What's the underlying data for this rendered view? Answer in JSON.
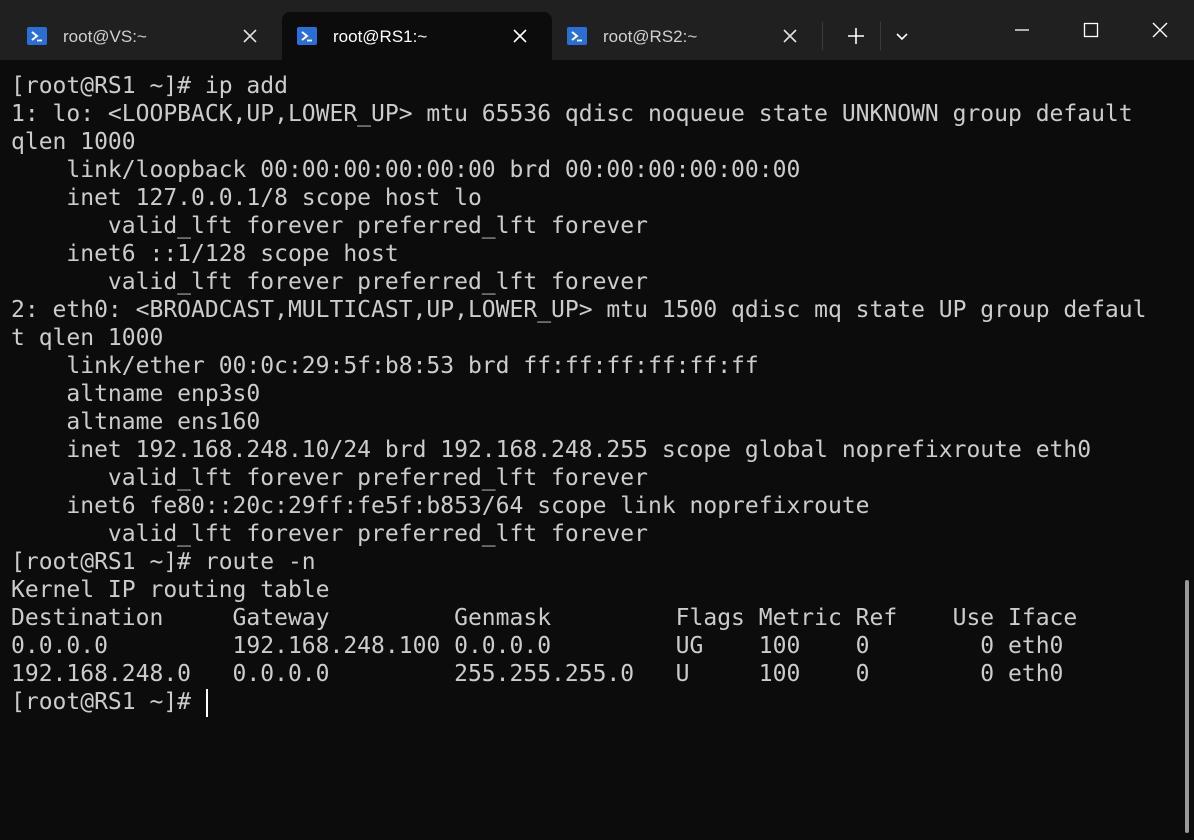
{
  "window": {
    "tabs": [
      {
        "title": "root@VS:~",
        "active": false
      },
      {
        "title": "root@RS1:~",
        "active": true
      },
      {
        "title": "root@RS2:~",
        "active": false
      }
    ]
  },
  "terminal": {
    "lines": [
      "[root@RS1 ~]# ip add",
      "1: lo: <LOOPBACK,UP,LOWER_UP> mtu 65536 qdisc noqueue state UNKNOWN group default",
      "qlen 1000",
      "    link/loopback 00:00:00:00:00:00 brd 00:00:00:00:00:00",
      "    inet 127.0.0.1/8 scope host lo",
      "       valid_lft forever preferred_lft forever",
      "    inet6 ::1/128 scope host",
      "       valid_lft forever preferred_lft forever",
      "2: eth0: <BROADCAST,MULTICAST,UP,LOWER_UP> mtu 1500 qdisc mq state UP group defaul",
      "t qlen 1000",
      "    link/ether 00:0c:29:5f:b8:53 brd ff:ff:ff:ff:ff:ff",
      "    altname enp3s0",
      "    altname ens160",
      "    inet 192.168.248.10/24 brd 192.168.248.255 scope global noprefixroute eth0",
      "       valid_lft forever preferred_lft forever",
      "    inet6 fe80::20c:29ff:fe5f:b853/64 scope link noprefixroute",
      "       valid_lft forever preferred_lft forever",
      "[root@RS1 ~]# route -n",
      "Kernel IP routing table",
      "Destination     Gateway         Genmask         Flags Metric Ref    Use Iface",
      "0.0.0.0         192.168.248.100 0.0.0.0         UG    100    0        0 eth0",
      "192.168.248.0   0.0.0.0         255.255.255.0   U     100    0        0 eth0",
      "[root@RS1 ~]# "
    ]
  },
  "colors": {
    "terminal_bg": "#0c0c0c",
    "titlebar_bg": "#202020",
    "text": "#cccccc",
    "powershell_blue": "#2b6fd6"
  },
  "icons": {
    "tab_icon": "powershell-icon",
    "close": "close-icon",
    "new_tab": "plus-icon",
    "dropdown": "chevron-down-icon",
    "minimize": "minimize-icon",
    "maximize": "maximize-icon",
    "window_close": "window-close-icon"
  }
}
